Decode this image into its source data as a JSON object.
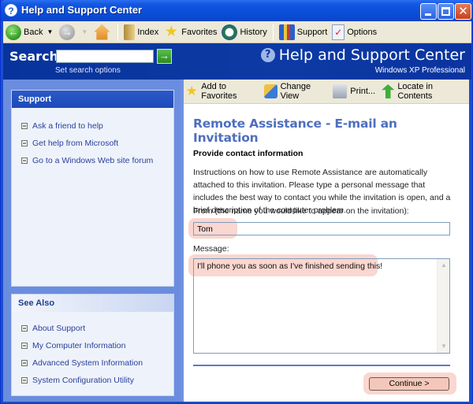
{
  "window": {
    "title": "Help and Support Center"
  },
  "toolbar": {
    "back": "Back",
    "index": "Index",
    "favorites": "Favorites",
    "history": "History",
    "support": "Support",
    "options": "Options"
  },
  "header": {
    "search_label": "Search",
    "search_value": "",
    "search_placeholder": "",
    "search_options": "Set search options",
    "brand_title": "Help and Support Center",
    "brand_subtitle": "Windows XP Professional"
  },
  "sidebar": {
    "support": {
      "title": "Support",
      "items": [
        {
          "label": "Ask a friend to help"
        },
        {
          "label": "Get help from Microsoft"
        },
        {
          "label": "Go to a Windows Web site forum"
        }
      ]
    },
    "see_also": {
      "title": "See Also",
      "items": [
        {
          "label": "About Support"
        },
        {
          "label": "My Computer Information"
        },
        {
          "label": "Advanced System Information"
        },
        {
          "label": "System Configuration Utility"
        }
      ]
    }
  },
  "content_toolbar": {
    "add_favorites": "Add to Favorites",
    "change_view": "Change View",
    "print": "Print...",
    "locate": "Locate in Contents"
  },
  "content": {
    "title": "Remote Assistance - E-mail an Invitation",
    "subtitle": "Provide contact information",
    "description": "Instructions on how to use Remote Assistance are automatically attached to this invitation. Please type a personal message that includes the best way to contact you while the invitation is open, and a brief description of the computer problem.",
    "from_label": "From (the name you would like to appear on the invitation):",
    "from_value": "Tom",
    "message_label": "Message:",
    "message_value": "I'll phone you as soon as I've finished sending this!",
    "continue_label": "Continue >"
  },
  "colors": {
    "title_bar": "#0a4ed8",
    "header_band": "#0c38a0",
    "content_title": "#4e6fbf",
    "highlight": "#f08c78"
  }
}
